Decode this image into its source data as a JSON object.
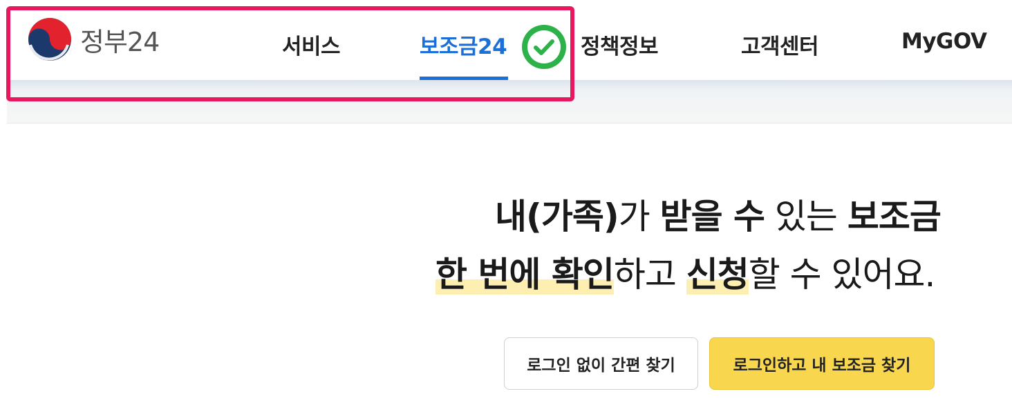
{
  "header": {
    "logo": {
      "icon": "taegeuk-emblem-icon",
      "text": "정부24"
    },
    "nav": [
      {
        "label": "서비스",
        "active": false
      },
      {
        "label": "보조금24",
        "active": true
      },
      {
        "label": "정책정보",
        "active": false
      },
      {
        "label": "고객센터",
        "active": false
      },
      {
        "label": "MyGOV",
        "active": false
      }
    ],
    "annotation": {
      "icon": "check-circle-icon"
    }
  },
  "hero": {
    "line1": [
      {
        "text": "내(가족)",
        "style": "bold"
      },
      {
        "text": "가 ",
        "style": "normal"
      },
      {
        "text": "받을 수",
        "style": "bold"
      },
      {
        "text": " 있는 ",
        "style": "normal"
      },
      {
        "text": "보조금",
        "style": "bold"
      }
    ],
    "line2": [
      {
        "text": "한 번에 확인",
        "style": "highlight"
      },
      {
        "text": "하고 ",
        "style": "normal"
      },
      {
        "text": "신청",
        "style": "highlight"
      },
      {
        "text": "할 수 있어요.",
        "style": "normal"
      }
    ]
  },
  "buttons": {
    "easy_search": "로그인 없이 간편 찾기",
    "login_search": "로그인하고 내 보조금 찾기"
  },
  "colors": {
    "active_nav": "#1c6fd6",
    "highlight_box": "#e8185f",
    "check_badge": "#2db24a",
    "primary_button": "#f8d64e",
    "text_highlight": "#fdeeb1"
  }
}
